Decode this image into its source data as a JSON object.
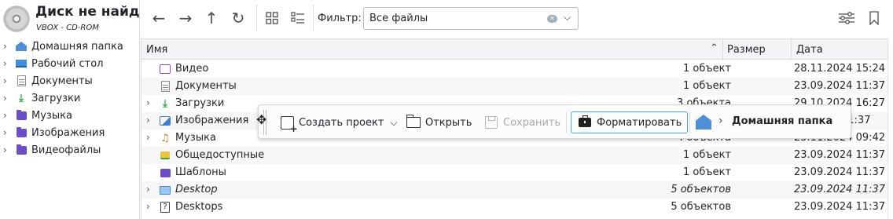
{
  "disk": {
    "title": "Диск не найден",
    "subtitle": "VBOX - CD-ROM"
  },
  "sidebar": {
    "items": [
      {
        "label": "Домашняя папка",
        "icon": "home-icon"
      },
      {
        "label": "Рабочий стол",
        "icon": "desktop-icon"
      },
      {
        "label": "Документы",
        "icon": "document-icon"
      },
      {
        "label": "Загрузки",
        "icon": "download-icon"
      },
      {
        "label": "Музыка",
        "icon": "folder-icon"
      },
      {
        "label": "Изображения",
        "icon": "folder-icon"
      },
      {
        "label": "Видеофайлы",
        "icon": "folder-icon"
      }
    ]
  },
  "toolbar": {
    "back_icon": "←",
    "forward_icon": "→",
    "up_icon": "↑",
    "reload_icon": "↻",
    "filter_label": "Фильтр:",
    "filter_value": "Все файлы",
    "filter_clear_icon": "✕",
    "filter_dropdown_icon": "⌵"
  },
  "table": {
    "columns": {
      "name": "Имя",
      "size": "Размер",
      "date": "Дата"
    },
    "sort_indicator": "⌃",
    "rows": [
      {
        "name": "Видео",
        "size": "1 объект",
        "date": "28.11.2024 15:24",
        "expand": false,
        "icon": "video-icon",
        "italic": false
      },
      {
        "name": "Документы",
        "size": "1 объект",
        "date": "23.09.2024 11:37",
        "expand": false,
        "icon": "document-icon",
        "italic": false
      },
      {
        "name": "Загрузки",
        "size": "3 объекта",
        "date": "29.10.2024 16:27",
        "expand": true,
        "icon": "download-icon",
        "italic": false
      },
      {
        "name": "Изображения",
        "size": "",
        "date": "11:37",
        "expand": true,
        "icon": "image-icon",
        "italic": false
      },
      {
        "name": "Музыка",
        "size": "4 объекта",
        "date": "25.11.2024 09:42",
        "expand": true,
        "icon": "music-icon",
        "italic": false
      },
      {
        "name": "Общедоступные",
        "size": "1 объект",
        "date": "23.09.2024 11:37",
        "expand": false,
        "icon": "public-folder-icon",
        "italic": false
      },
      {
        "name": "Шаблоны",
        "size": "1 объект",
        "date": "23.09.2024 11:37",
        "expand": false,
        "icon": "templates-folder-icon",
        "italic": false
      },
      {
        "name": "Desktop",
        "size": "5 объектов",
        "date": "23.09.2024 11:37",
        "expand": true,
        "icon": "desktop-folder-icon",
        "italic": true
      },
      {
        "name": "Desktops",
        "size": "5 объектов",
        "date": "23.09.2024 11:37",
        "expand": true,
        "icon": "unknown-file-icon",
        "italic": false
      }
    ]
  },
  "popup": {
    "drag_icon": "✥",
    "new_project": "Создать проект",
    "new_project_dropdown_icon": "⌵",
    "open": "Открыть",
    "save": "Сохранить",
    "format": "Форматировать",
    "breadcrumb_chevron": "›",
    "breadcrumb": "Домашняя папка"
  },
  "colors": {
    "accent": "#3daee9",
    "folder": "#6a4ec9",
    "home": "#4e8fd8",
    "download": "#2eae3f",
    "music": "#e07a1f"
  }
}
